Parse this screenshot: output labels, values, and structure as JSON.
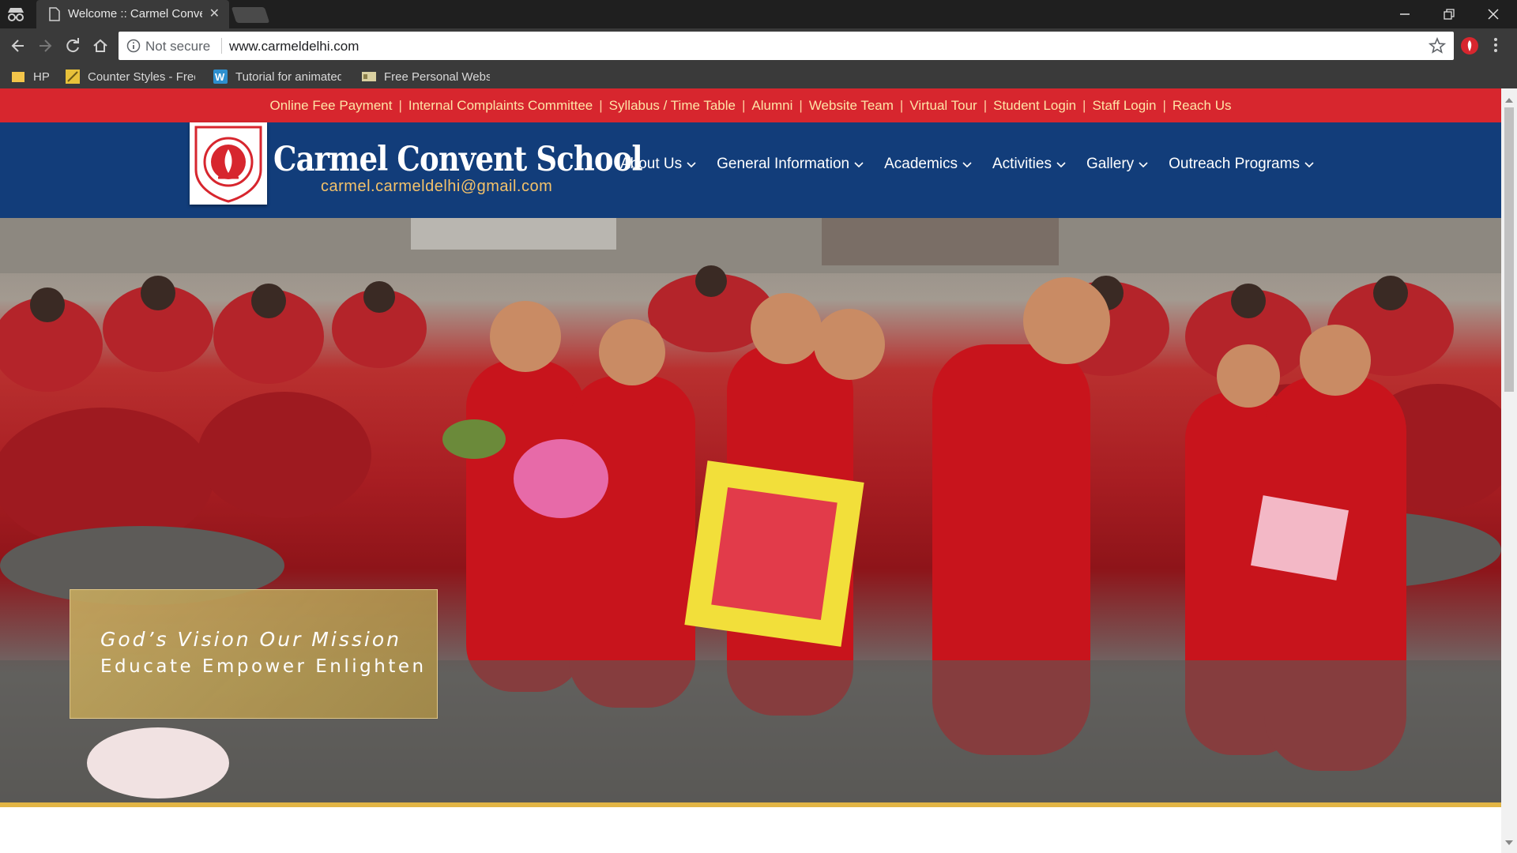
{
  "browser": {
    "tab_title": "Welcome :: Carmel Convent School",
    "security_label": "Not secure",
    "url": "www.carmeldelhi.com",
    "bookmarks": [
      {
        "label": "HP"
      },
      {
        "label": "Counter Styles - Free"
      },
      {
        "label": "Tutorial for animated"
      },
      {
        "label": "Free Personal Website"
      }
    ]
  },
  "topbar": {
    "links": [
      "Online Fee Payment",
      "Internal Complaints Committee",
      "Syllabus / Time Table",
      "Alumni",
      "Website Team",
      "Virtual Tour",
      "Student Login",
      "Staff Login",
      "Reach Us"
    ]
  },
  "header": {
    "school_name": "Carmel Convent School",
    "email": "carmel.carmeldelhi@gmail.com",
    "nav": [
      "About Us",
      "General Information",
      "Academics",
      "Activities",
      "Gallery",
      "Outreach Programs"
    ]
  },
  "hero": {
    "tagline_line1": "God’s Vision Our Mission",
    "tagline_line2": "Educate Empower Enlighten"
  },
  "colors": {
    "topbar_bg": "#d7262e",
    "topbar_link": "#ffe3a6",
    "header_bg": "#123d7a",
    "email_color": "#f4c26a",
    "hero_accent_line": "#e2b545"
  }
}
